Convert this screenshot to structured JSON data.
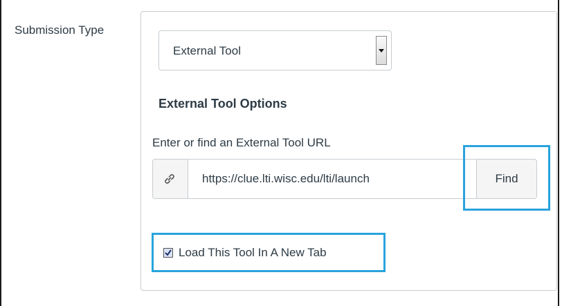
{
  "submission": {
    "label": "Submission Type",
    "selected_value": "External Tool"
  },
  "external_tool": {
    "heading": "External Tool Options",
    "url_label": "Enter or find an External Tool URL",
    "url_value": "https://clue.lti.wisc.edu/lti/launch",
    "find_label": "Find",
    "link_icon": "link-icon"
  },
  "new_tab": {
    "label": "Load This Tool In A New Tab",
    "checked": true
  },
  "colors": {
    "highlight": "#29a3dd",
    "text": "#2d3b45",
    "border": "#c7cdd1"
  }
}
